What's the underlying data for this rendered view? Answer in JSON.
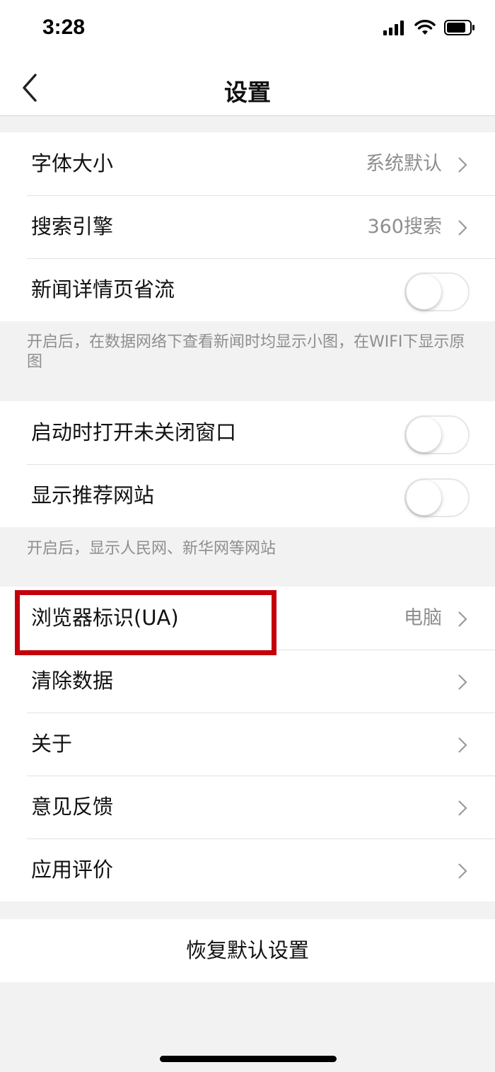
{
  "status": {
    "time": "3:28",
    "signal_icon": "cellular-signal-icon",
    "wifi_icon": "wifi-icon",
    "battery_icon": "battery-icon"
  },
  "nav": {
    "title": "设置",
    "back_icon": "chevron-left-icon"
  },
  "group1": {
    "font_size": {
      "label": "字体大小",
      "value": "系统默认"
    },
    "search_engine": {
      "label": "搜索引擎",
      "value": "360搜索"
    },
    "data_saver": {
      "label": "新闻详情页省流",
      "enabled": false
    },
    "note": "开启后，在数据网络下查看新闻时均显示小图，在WIFI下显示原图"
  },
  "group2": {
    "restore_windows": {
      "label": "启动时打开未关闭窗口",
      "enabled": false
    },
    "recommended_sites": {
      "label": "显示推荐网站",
      "enabled": false
    },
    "note": "开启后，显示人民网、新华网等网站"
  },
  "group3": {
    "user_agent": {
      "label": "浏览器标识(UA)",
      "value": "电脑"
    },
    "clear_data": {
      "label": "清除数据"
    },
    "about": {
      "label": "关于"
    },
    "feedback": {
      "label": "意见反馈"
    },
    "rate_app": {
      "label": "应用评价"
    }
  },
  "reset": {
    "label": "恢复默认设置"
  },
  "colors": {
    "highlight": "#c4000b",
    "background": "#f2f2f2"
  }
}
